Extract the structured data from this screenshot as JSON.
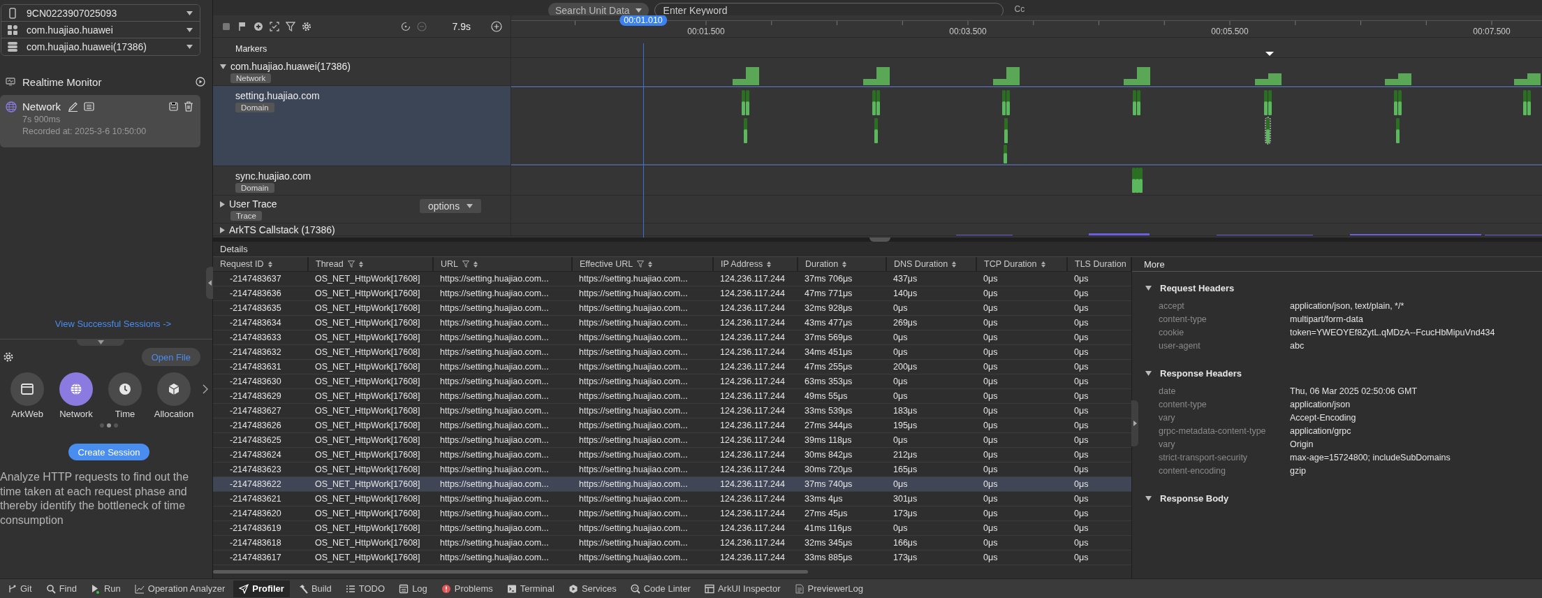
{
  "top_bar": {
    "search_scope": "Search Unit Data",
    "search": {
      "placeholder": "Enter Keyword"
    },
    "case_toggle": "Cc"
  },
  "left_panel": {
    "selectors": [
      {
        "kind": "device",
        "value": "9CN0223907025093"
      },
      {
        "kind": "app",
        "value": "com.huajiao.huawei"
      },
      {
        "kind": "process",
        "value": "com.huajiao.huawei(17386)"
      }
    ],
    "realtime_monitor": "Realtime Monitor",
    "sessions": [
      {
        "title": "Network",
        "duration": "7s 900ms",
        "recorded": "Recorded at: 2025-3-6 10:50:00",
        "selected": true
      }
    ],
    "view_sessions_link": "View Successful Sessions ->",
    "open_file": "Open File",
    "templates": [
      {
        "kind": "arkweb",
        "label": "ArkWeb",
        "selected": false
      },
      {
        "kind": "network",
        "label": "Network",
        "selected": true
      },
      {
        "kind": "time",
        "label": "Time",
        "selected": false
      },
      {
        "kind": "allocation",
        "label": "Allocation",
        "selected": false
      }
    ],
    "create_session": "Create Session",
    "description": "Analyze HTTP requests to find out the time taken at each request phase and thereby identify the bottleneck of time consumption"
  },
  "timeline": {
    "zoom_label": "7.9s",
    "playhead": "00:01.010",
    "ticks": [
      "00:01.500",
      "00:03.500",
      "00:05.500",
      "00:07.500"
    ],
    "rows": [
      {
        "kind": "markers",
        "title": "Markers",
        "selected": false
      },
      {
        "kind": "group",
        "title": "com.huajiao.huawei(17386)",
        "tag": "Network",
        "expanded": true,
        "selected": false
      },
      {
        "kind": "domain",
        "title": "setting.huajiao.com",
        "tag": "Domain",
        "selected": true
      },
      {
        "kind": "domain",
        "title": "sync.huajiao.com",
        "tag": "Domain",
        "selected": false
      },
      {
        "kind": "group",
        "title": "User Trace",
        "tag": "Trace",
        "expanded": false,
        "options": "options",
        "selected": false
      },
      {
        "kind": "group",
        "title": "ArkTS Callstack (17386)",
        "expanded": false,
        "selected": false
      }
    ]
  },
  "details": {
    "title": "Details",
    "columns": [
      {
        "title": "Request ID",
        "filter": false
      },
      {
        "title": "Thread",
        "filter": true
      },
      {
        "title": "URL",
        "filter": true
      },
      {
        "title": "Effective URL",
        "filter": true
      },
      {
        "title": "IP Address",
        "filter": false
      },
      {
        "title": "Duration",
        "filter": false
      },
      {
        "title": "DNS Duration",
        "filter": false
      },
      {
        "title": "TCP Duration",
        "filter": false
      },
      {
        "title": "TLS Duration",
        "filter": false
      }
    ],
    "rows": [
      {
        "selected": false,
        "cells": [
          "-2147483637",
          "OS_NET_HttpWork[17608]",
          "https://setting.huajiao.com...",
          "https://setting.huajiao.com...",
          "124.236.117.244",
          "37ms 706μs",
          "437μs",
          "0μs",
          "0μs"
        ]
      },
      {
        "selected": false,
        "cells": [
          "-2147483636",
          "OS_NET_HttpWork[17608]",
          "https://setting.huajiao.com...",
          "https://setting.huajiao.com...",
          "124.236.117.244",
          "47ms 771μs",
          "140μs",
          "0μs",
          "0μs"
        ]
      },
      {
        "selected": false,
        "cells": [
          "-2147483635",
          "OS_NET_HttpWork[17608]",
          "https://setting.huajiao.com...",
          "https://setting.huajiao.com...",
          "124.236.117.244",
          "32ms 928μs",
          "0μs",
          "0μs",
          "0μs"
        ]
      },
      {
        "selected": false,
        "cells": [
          "-2147483634",
          "OS_NET_HttpWork[17608]",
          "https://setting.huajiao.com...",
          "https://setting.huajiao.com...",
          "124.236.117.244",
          "43ms 477μs",
          "269μs",
          "0μs",
          "0μs"
        ]
      },
      {
        "selected": false,
        "cells": [
          "-2147483633",
          "OS_NET_HttpWork[17608]",
          "https://setting.huajiao.com...",
          "https://setting.huajiao.com...",
          "124.236.117.244",
          "37ms 569μs",
          "0μs",
          "0μs",
          "0μs"
        ]
      },
      {
        "selected": false,
        "cells": [
          "-2147483632",
          "OS_NET_HttpWork[17608]",
          "https://setting.huajiao.com...",
          "https://setting.huajiao.com...",
          "124.236.117.244",
          "34ms 451μs",
          "0μs",
          "0μs",
          "0μs"
        ]
      },
      {
        "selected": false,
        "cells": [
          "-2147483631",
          "OS_NET_HttpWork[17608]",
          "https://setting.huajiao.com...",
          "https://setting.huajiao.com...",
          "124.236.117.244",
          "47ms 255μs",
          "200μs",
          "0μs",
          "0μs"
        ]
      },
      {
        "selected": false,
        "cells": [
          "-2147483630",
          "OS_NET_HttpWork[17608]",
          "https://setting.huajiao.com...",
          "https://setting.huajiao.com...",
          "124.236.117.244",
          "63ms 353μs",
          "0μs",
          "0μs",
          "0μs"
        ]
      },
      {
        "selected": false,
        "cells": [
          "-2147483629",
          "OS_NET_HttpWork[17608]",
          "https://setting.huajiao.com...",
          "https://setting.huajiao.com...",
          "124.236.117.244",
          "49ms 55μs",
          "0μs",
          "0μs",
          "0μs"
        ]
      },
      {
        "selected": false,
        "cells": [
          "-2147483627",
          "OS_NET_HttpWork[17608]",
          "https://setting.huajiao.com...",
          "https://setting.huajiao.com...",
          "124.236.117.244",
          "33ms 539μs",
          "183μs",
          "0μs",
          "0μs"
        ]
      },
      {
        "selected": false,
        "cells": [
          "-2147483626",
          "OS_NET_HttpWork[17608]",
          "https://setting.huajiao.com...",
          "https://setting.huajiao.com...",
          "124.236.117.244",
          "27ms 344μs",
          "195μs",
          "0μs",
          "0μs"
        ]
      },
      {
        "selected": false,
        "cells": [
          "-2147483625",
          "OS_NET_HttpWork[17608]",
          "https://setting.huajiao.com...",
          "https://setting.huajiao.com...",
          "124.236.117.244",
          "39ms 118μs",
          "0μs",
          "0μs",
          "0μs"
        ]
      },
      {
        "selected": false,
        "cells": [
          "-2147483624",
          "OS_NET_HttpWork[17608]",
          "https://setting.huajiao.com...",
          "https://setting.huajiao.com...",
          "124.236.117.244",
          "30ms 842μs",
          "212μs",
          "0μs",
          "0μs"
        ]
      },
      {
        "selected": false,
        "cells": [
          "-2147483623",
          "OS_NET_HttpWork[17608]",
          "https://setting.huajiao.com...",
          "https://setting.huajiao.com...",
          "124.236.117.244",
          "30ms 720μs",
          "165μs",
          "0μs",
          "0μs"
        ]
      },
      {
        "selected": true,
        "cells": [
          "-2147483622",
          "OS_NET_HttpWork[17608]",
          "https://setting.huajiao.com...",
          "https://setting.huajiao.com...",
          "124.236.117.244",
          "37ms 740μs",
          "0μs",
          "0μs",
          "0μs"
        ]
      },
      {
        "selected": false,
        "cells": [
          "-2147483621",
          "OS_NET_HttpWork[17608]",
          "https://setting.huajiao.com...",
          "https://setting.huajiao.com...",
          "124.236.117.244",
          "33ms 4μs",
          "301μs",
          "0μs",
          "0μs"
        ]
      },
      {
        "selected": false,
        "cells": [
          "-2147483620",
          "OS_NET_HttpWork[17608]",
          "https://setting.huajiao.com...",
          "https://setting.huajiao.com...",
          "124.236.117.244",
          "27ms 45μs",
          "173μs",
          "0μs",
          "0μs"
        ]
      },
      {
        "selected": false,
        "cells": [
          "-2147483619",
          "OS_NET_HttpWork[17608]",
          "https://setting.huajiao.com...",
          "https://setting.huajiao.com...",
          "124.236.117.244",
          "41ms 116μs",
          "0μs",
          "0μs",
          "0μs"
        ]
      },
      {
        "selected": false,
        "cells": [
          "-2147483618",
          "OS_NET_HttpWork[17608]",
          "https://setting.huajiao.com...",
          "https://setting.huajiao.com...",
          "124.236.117.244",
          "32ms 345μs",
          "166μs",
          "0μs",
          "0μs"
        ]
      },
      {
        "selected": false,
        "cells": [
          "-2147483617",
          "OS_NET_HttpWork[17608]",
          "https://setting.huajiao.com...",
          "https://setting.huajiao.com...",
          "124.236.117.244",
          "33ms 885μs",
          "173μs",
          "0μs",
          "0μs"
        ]
      }
    ]
  },
  "more_panel": {
    "title": "More",
    "sections": [
      {
        "title": "Request Headers",
        "expanded": true,
        "entries": [
          {
            "name": "accept",
            "value": "application/json, text/plain, */*"
          },
          {
            "name": "content-type",
            "value": "multipart/form-data"
          },
          {
            "name": "cookie",
            "value": "token=YWEOYEf8ZytL.qMDzA--FcucHbMipuVnd434"
          },
          {
            "name": "user-agent",
            "value": "abc"
          }
        ]
      },
      {
        "title": "Response Headers",
        "expanded": true,
        "entries": [
          {
            "name": "date",
            "value": "Thu, 06 Mar 2025 02:50:06 GMT"
          },
          {
            "name": "content-type",
            "value": "application/json"
          },
          {
            "name": "vary",
            "value": "Accept-Encoding"
          },
          {
            "name": "grpc-metadata-content-type",
            "value": "application/grpc"
          },
          {
            "name": "vary",
            "value": "Origin"
          },
          {
            "name": "strict-transport-security",
            "value": "max-age=15724800; includeSubDomains"
          },
          {
            "name": "content-encoding",
            "value": "gzip"
          }
        ]
      },
      {
        "title": "Response Body",
        "expanded": true
      }
    ]
  },
  "bottom_bar": [
    {
      "kind": "git",
      "label": "Git",
      "selected": false
    },
    {
      "kind": "find",
      "label": "Find",
      "selected": false
    },
    {
      "kind": "run",
      "label": "Run",
      "selected": false
    },
    {
      "kind": "analyzer",
      "label": "Operation Analyzer",
      "selected": false
    },
    {
      "kind": "profiler",
      "label": "Profiler",
      "selected": true
    },
    {
      "kind": "build",
      "label": "Build",
      "selected": false
    },
    {
      "kind": "todo",
      "label": "TODO",
      "selected": false
    },
    {
      "kind": "log",
      "label": "Log",
      "selected": false
    },
    {
      "kind": "problems",
      "label": "Problems",
      "selected": false
    },
    {
      "kind": "terminal",
      "label": "Terminal",
      "selected": false
    },
    {
      "kind": "services",
      "label": "Services",
      "selected": false
    },
    {
      "kind": "linter",
      "label": "Code Linter",
      "selected": false
    },
    {
      "kind": "inspector",
      "label": "ArkUI Inspector",
      "selected": false
    },
    {
      "kind": "previewer",
      "label": "PreviewerLog",
      "selected": false
    }
  ]
}
